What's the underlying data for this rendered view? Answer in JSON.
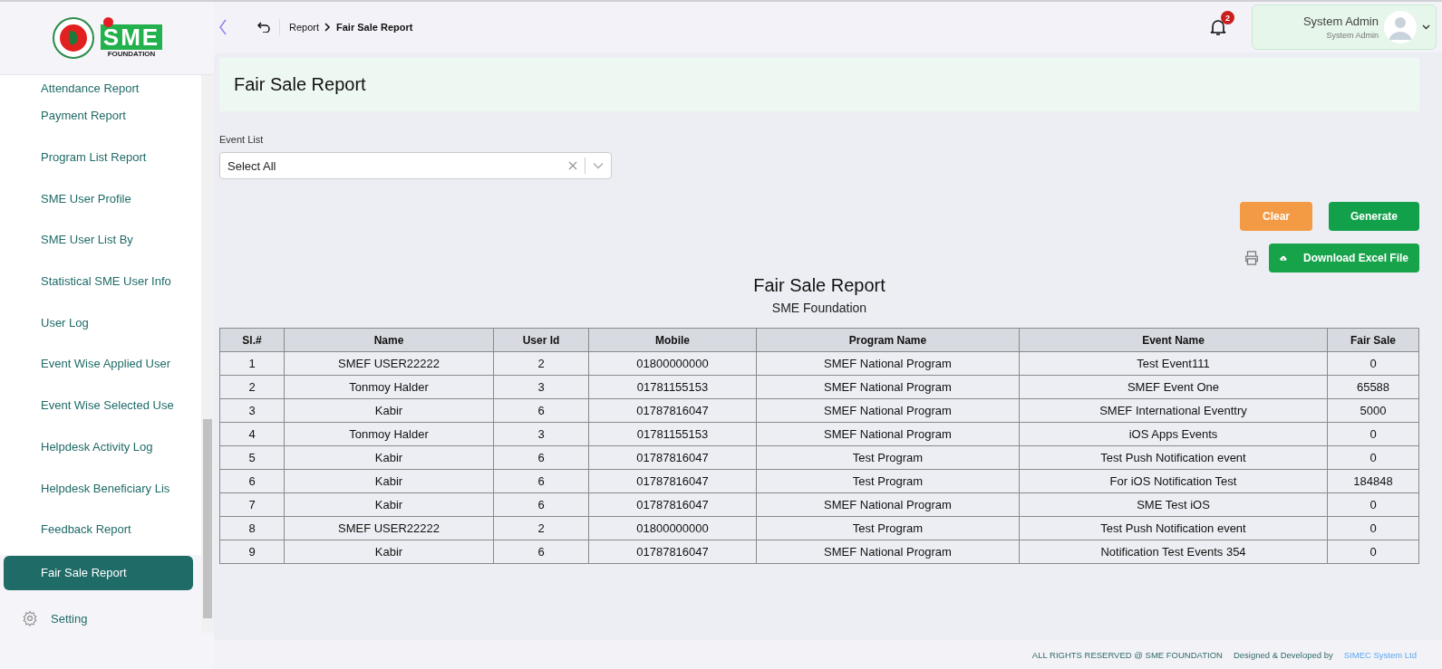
{
  "header": {
    "breadcrumb": [
      {
        "label": "Report",
        "current": false
      },
      {
        "label": "Fair Sale Report",
        "current": true
      }
    ],
    "notification_count": "2",
    "user": {
      "name": "System Admin",
      "role": "System Admin"
    }
  },
  "logo": {
    "text": "SME",
    "subtext": "FOUNDATION"
  },
  "sidebar": {
    "items": [
      {
        "label": "Attendance Report",
        "selected": false
      },
      {
        "label": "Payment Report",
        "selected": false
      },
      {
        "label": "Program List Report",
        "selected": false
      },
      {
        "label": "SME User Profile",
        "selected": false
      },
      {
        "label": "SME User List By",
        "selected": false
      },
      {
        "label": "Statistical SME User Info",
        "selected": false
      },
      {
        "label": "User Log",
        "selected": false
      },
      {
        "label": "Event Wise Applied User",
        "selected": false
      },
      {
        "label": "Event Wise Selected Use",
        "selected": false
      },
      {
        "label": "Helpdesk Activity Log",
        "selected": false
      },
      {
        "label": "Helpdesk Beneficiary Lis",
        "selected": false
      },
      {
        "label": "Feedback Report",
        "selected": false
      },
      {
        "label": "Fair Sale Report",
        "selected": true
      }
    ],
    "footer_item": {
      "label": "Setting"
    }
  },
  "page_title": "Fair Sale Report",
  "filter": {
    "label": "Event List",
    "value": "Select All"
  },
  "buttons": {
    "clear": "Clear",
    "generate": "Generate",
    "download": "Download Excel File"
  },
  "report": {
    "title": "Fair Sale Report",
    "subtitle": "SME Foundation"
  },
  "table": {
    "columns": [
      "Sl.#",
      "Name",
      "User Id",
      "Mobile",
      "Program Name",
      "Event Name",
      "Fair Sale"
    ],
    "rows": [
      [
        "1",
        "SMEF USER22222",
        "2",
        "01800000000",
        "SMEF National Program",
        "Test Event111",
        "0"
      ],
      [
        "2",
        "Tonmoy Halder",
        "3",
        "01781155153",
        "SMEF National Program",
        "SMEF Event One",
        "65588"
      ],
      [
        "3",
        "Kabir",
        "6",
        "01787816047",
        "SMEF National Program",
        "SMEF International Eventtry",
        "5000"
      ],
      [
        "4",
        "Tonmoy Halder",
        "3",
        "01781155153",
        "SMEF National Program",
        "iOS Apps Events",
        "0"
      ],
      [
        "5",
        "Kabir",
        "6",
        "01787816047",
        "Test Program",
        "Test Push Notification event",
        "0"
      ],
      [
        "6",
        "Kabir",
        "6",
        "01787816047",
        "Test Program",
        "For iOS Notification Test",
        "184848"
      ],
      [
        "7",
        "Kabir",
        "6",
        "01787816047",
        "SMEF National Program",
        "SME Test iOS",
        "0"
      ],
      [
        "8",
        "SMEF USER22222",
        "2",
        "01800000000",
        "Test Program",
        "Test Push Notification event",
        "0"
      ],
      [
        "9",
        "Kabir",
        "6",
        "01787816047",
        "SMEF National Program",
        "Notification Test Events 354",
        "0"
      ]
    ]
  },
  "footer": {
    "rights": "ALL RIGHTS RESERVED @ SME FOUNDATION",
    "designed": "Designed & Developed by",
    "company": "SIMEC System Ltd"
  }
}
